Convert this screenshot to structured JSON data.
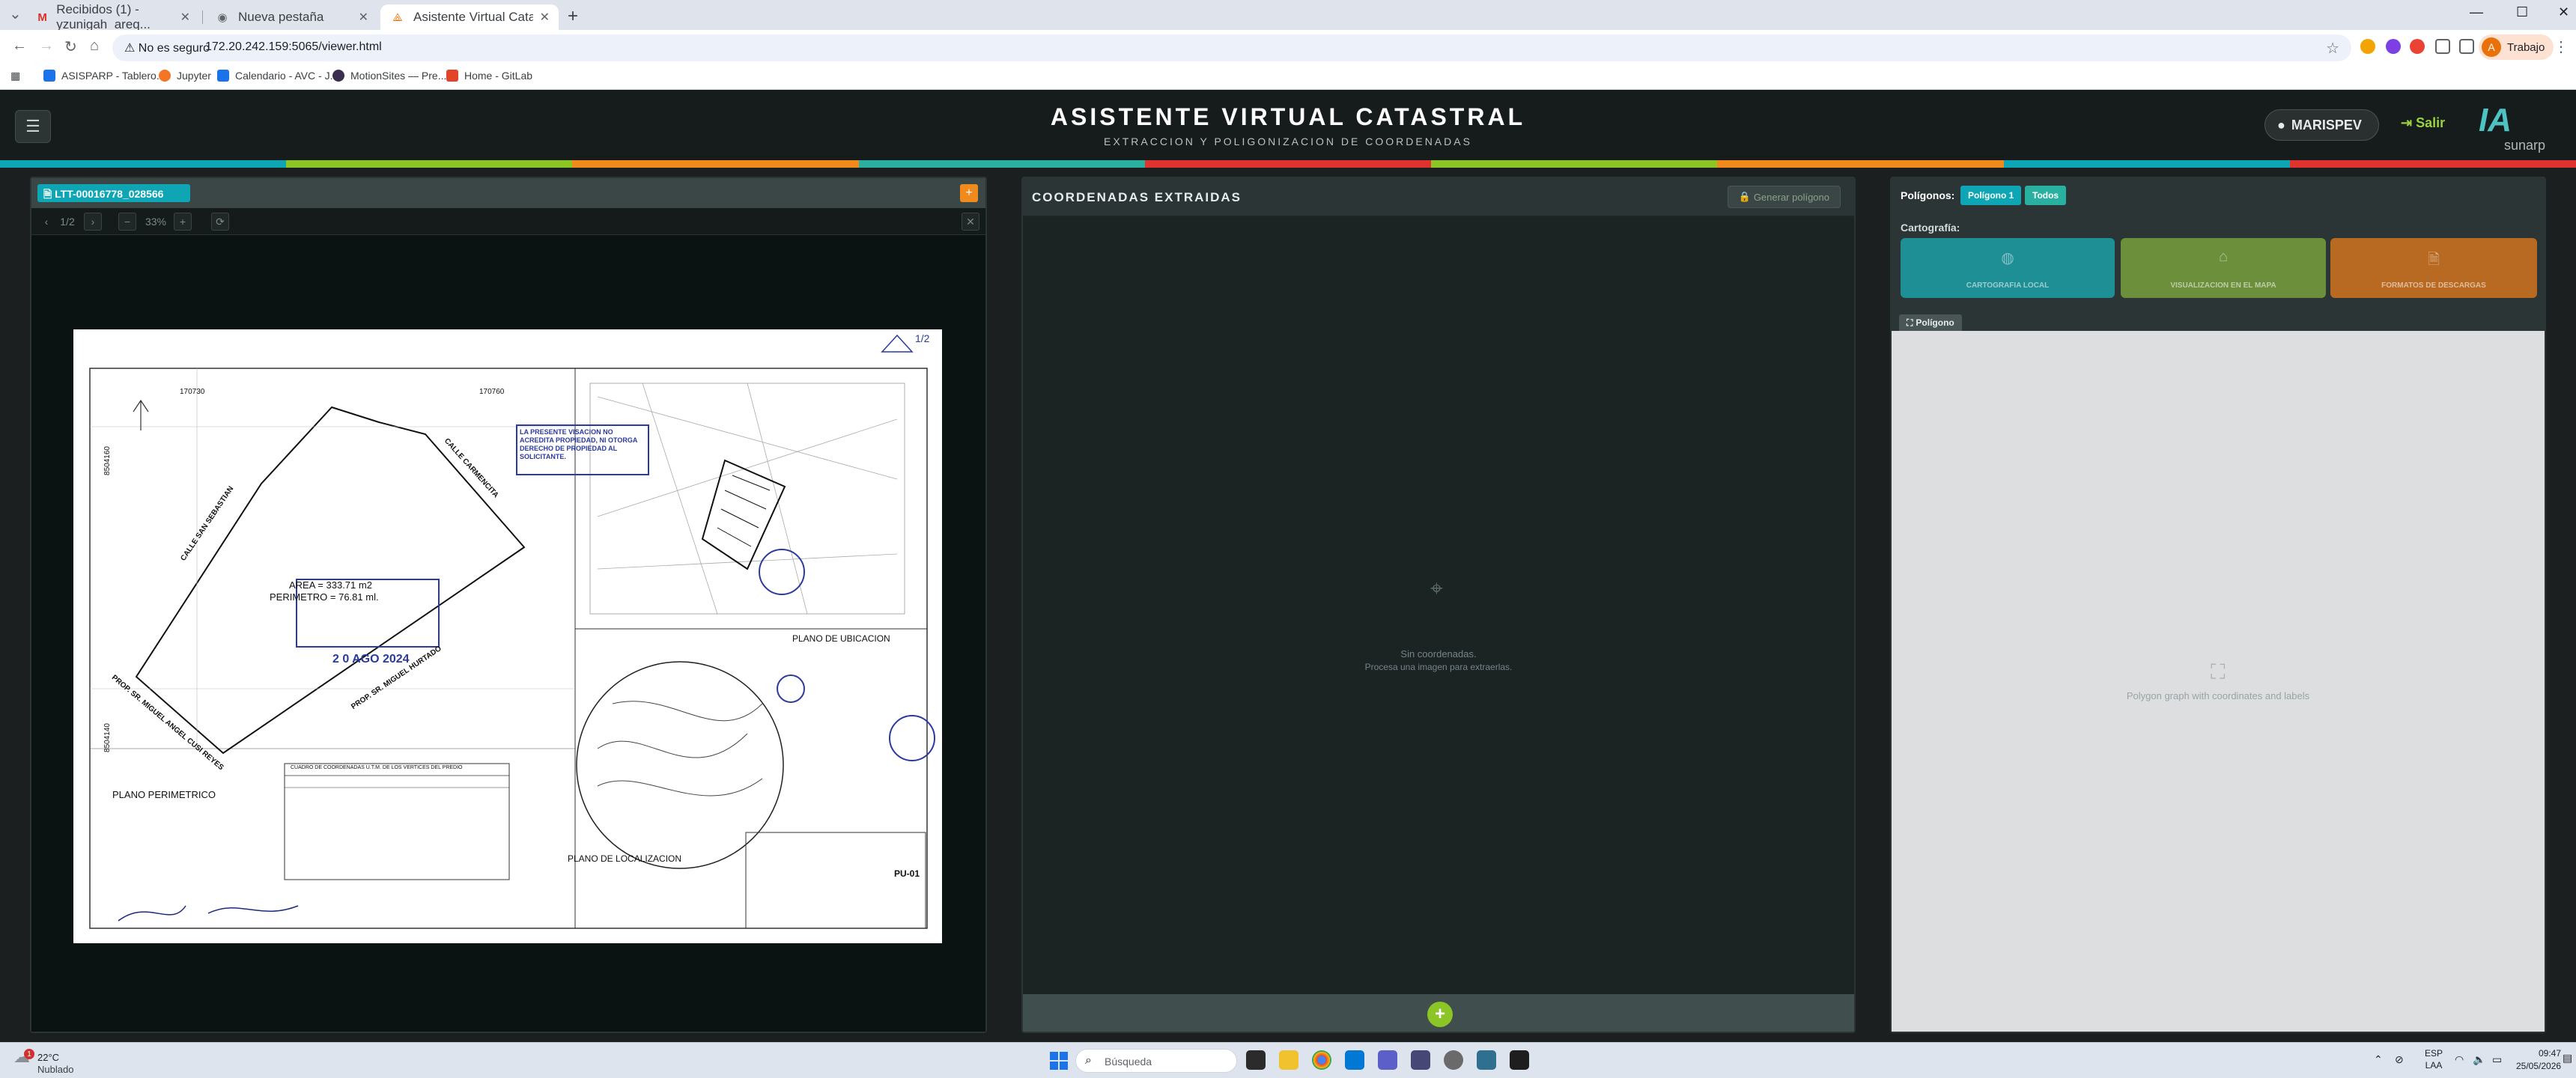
{
  "browser": {
    "tabs": [
      {
        "title": "Recibidos (1) - yzunigah_areq...",
        "icon": "gmail-icon"
      },
      {
        "title": "Nueva pestaña",
        "icon": "chrome-icon"
      },
      {
        "title": "Asistente Virtual Catastral — V...",
        "icon": "app-icon"
      }
    ],
    "security_label": "No es seguro",
    "url": "172.20.242.159:5065/viewer.html",
    "profile_label": "Trabajo",
    "profile_initial": "A",
    "bookmarks": [
      "ASISPARP - Tablero...",
      "Jupyter",
      "Calendario - AVC - J...",
      "MotionSites — Pre...",
      "Home - GitLab"
    ]
  },
  "app": {
    "title": "ASISTENTE VIRTUAL CATASTRAL",
    "subtitle": "EXTRACCION Y POLIGONIZACION DE COORDENADAS",
    "user": "MARISPEV",
    "exit_label": "Salir",
    "logo_main": "IA",
    "logo_sub": "sunarp",
    "stripe_colors": [
      "#0ea5b5",
      "#8bc526",
      "#f08a1c",
      "#2ab0a0",
      "#e0332f",
      "#8bc526",
      "#f08a1c",
      "#0ea5b5",
      "#e0332f"
    ]
  },
  "document": {
    "file_name": "LTT-00016778_028566",
    "page_indicator": "1/2",
    "zoom": "33%",
    "plano": {
      "area_text": "AREA = 333.71 m2",
      "perimeter_text": "PERIMETRO = 76.81 ml.",
      "title_perimetrico": "PLANO  PERIMETRICO",
      "title_ubicacion": "PLANO  DE UBICACION",
      "title_localizacion": "PLANO DE LOCALIZACION",
      "street_san_sebastian": "CALLE SAN SEBASTIAN",
      "street_carmencita": "CALLE CARMENCITA",
      "owner_hurtado": "PROP. SR. MIGUEL HURTADO",
      "owner_cusi": "PROP. SR. MIGUEL ANGEL CUSI REYES",
      "stamp_text": "LA PRESENTE VISACION NO ACREDITA PROPIEDAD, NI OTORGA DERECHO DE PROPIEDAD AL SOLICITANTE.",
      "date_stamp": "2 0 AGO 2024",
      "coord_x_left": "170730",
      "coord_x_right": "170760",
      "coord_y_top": "8504160",
      "coord_y_bottom": "8504140",
      "table_title": "CUADRO DE COORDENADAS U.T.M. DE LOS VERTICES DEL PREDIO",
      "sheet_code": "PU-01",
      "folio": "1/2"
    }
  },
  "coords": {
    "title": "COORDENADAS EXTRAIDAS",
    "generate_label": "Generar polígono",
    "empty_title": "Sin coordenadas.",
    "empty_hint": "Procesa una imagen para extraerlas."
  },
  "polygons": {
    "label": "Polígonos:",
    "tabs": [
      "Polígono 1",
      "Todos"
    ],
    "cartography_label": "Cartografía:",
    "cards": [
      {
        "label": "CARTOGRAFIA LOCAL",
        "color": "#1f8f96",
        "icon": "globe-icon"
      },
      {
        "label": "VISUALIZACION EN EL MAPA",
        "color": "#6b8f3a",
        "icon": "map-icon"
      },
      {
        "label": "FORMATOS DE DESCARGAS",
        "color": "#b86a22",
        "icon": "download-icon"
      }
    ],
    "graph_tab": "Polígono",
    "graph_placeholder": "Polygon graph with coordinates and labels"
  },
  "taskbar": {
    "temperature": "22°C",
    "weather": "Nublado",
    "weather_badge": "1",
    "search_placeholder": "Búsqueda",
    "language": "ESP",
    "language_sub": "LAA",
    "time": "09:47",
    "date": "25/05/2026"
  }
}
